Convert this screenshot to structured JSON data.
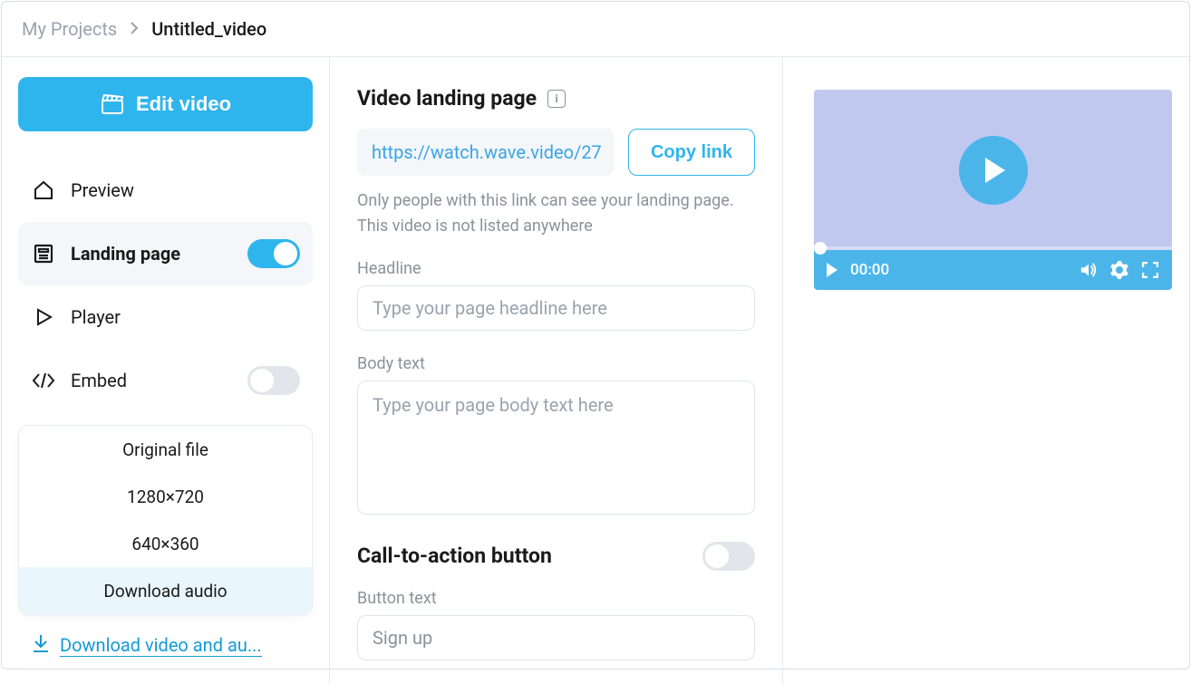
{
  "breadcrumb": {
    "root": "My Projects",
    "current": "Untitled_video"
  },
  "sidebar": {
    "edit_label": "Edit video",
    "items": [
      {
        "label": "Preview"
      },
      {
        "label": "Landing page"
      },
      {
        "label": "Player"
      },
      {
        "label": "Embed"
      }
    ],
    "download_options": [
      "Original file",
      "1280×720",
      "640×360",
      "Download audio"
    ],
    "download_link": "Download video and au..."
  },
  "main": {
    "title": "Video landing page",
    "share_url": "https://watch.wave.video/27",
    "copy_label": "Copy link",
    "help": "Only people with this link can see your landing page. This video is not listed anywhere",
    "headline_label": "Headline",
    "headline_placeholder": "Type your page headline here",
    "body_label": "Body text",
    "body_placeholder": "Type your page body text here",
    "cta_title": "Call-to-action button",
    "button_text_label": "Button text",
    "button_text_value": "Sign up"
  },
  "player": {
    "time": "00:00"
  }
}
